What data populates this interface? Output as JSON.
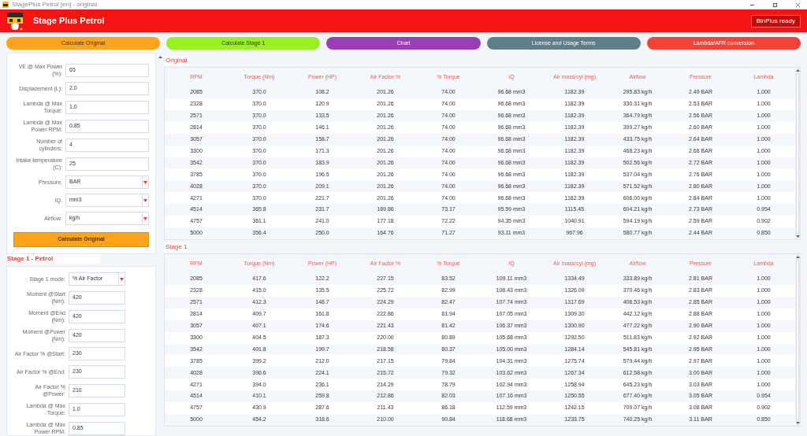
{
  "window": {
    "title": "StagePlus Petrol [en] - original"
  },
  "header": {
    "title": "Stage Plus Petrol",
    "status": "BinPlus ready"
  },
  "nav_buttons": [
    {
      "label": "Calculate Original",
      "color": "#ffa31a"
    },
    {
      "label": "Calculate Stage 1",
      "color": "#99f020"
    },
    {
      "label": "Chart",
      "color": "#9b3db5"
    },
    {
      "label": "License and Usage Terms",
      "color": "#607d8b"
    },
    {
      "label": "Lambda/AFR conversion",
      "color": "#f44336"
    }
  ],
  "original_form": {
    "fields": [
      {
        "label": "VE @ Max Power (%):",
        "kind": "text",
        "value": "65"
      },
      {
        "label": "Displacement (L):",
        "kind": "text",
        "value": "2.0"
      },
      {
        "label": "Lambda @ Max Torque:",
        "kind": "text",
        "value": "1.0"
      },
      {
        "label": "Lambda @ Max Power RPM:",
        "kind": "text",
        "value": "0.85"
      },
      {
        "label": "Number of cylinders:",
        "kind": "text",
        "value": "4"
      },
      {
        "label": "Intake temperature (C):",
        "kind": "text",
        "value": "25"
      },
      {
        "label": "Pressure:",
        "kind": "select",
        "value": "BAR"
      },
      {
        "label": "IQ:",
        "kind": "select",
        "value": "mm3"
      },
      {
        "label": "Airflow:",
        "kind": "select",
        "value": "kg/h"
      }
    ],
    "button": "Calculate Original"
  },
  "stage1_form": {
    "title": "Stage 1 - Petrol",
    "fields": [
      {
        "label": "Stage 1 mode:",
        "kind": "select",
        "value": "% Air Factor"
      },
      {
        "label": "Moment @Start (Nm):",
        "kind": "text",
        "value": "420"
      },
      {
        "label": "Moment @End (Nm):",
        "kind": "text",
        "value": "420"
      },
      {
        "label": "Moment @Power (Nm):",
        "kind": "text",
        "value": "420"
      },
      {
        "label": "Air Factor % @Start:",
        "kind": "text",
        "value": "230"
      },
      {
        "label": "Air Factor % @End:",
        "kind": "text",
        "value": "230"
      },
      {
        "label": "Air Factor % @Power:",
        "kind": "text",
        "value": "210"
      },
      {
        "label": "Lambda @ Max Torque:",
        "kind": "text",
        "value": "1.0"
      },
      {
        "label": "Lambda @ Max Power RPM:",
        "kind": "text",
        "value": "0.85"
      }
    ]
  },
  "tables": [
    {
      "title": "Original",
      "columns": [
        "RPM",
        "Torque (Nm)",
        "Power (HP)",
        "Air Factor %",
        "% Torque",
        "IQ",
        "Air mass/cyl (mg)",
        "Airflow",
        "Pressure",
        "Lambda"
      ],
      "rows": [
        [
          "2085",
          "370.0",
          "108.2",
          "201.26",
          "74.00",
          "96.68 mm3",
          "1182.39",
          "295.83 kg/h",
          "2.49 BAR",
          "1.000"
        ],
        [
          "2328",
          "370.0",
          "120.9",
          "201.26",
          "74.00",
          "96.68 mm3",
          "1182.39",
          "330.31 kg/h",
          "2.53 BAR",
          "1.000"
        ],
        [
          "2571",
          "370.0",
          "133.5",
          "201.26",
          "74.00",
          "96.68 mm3",
          "1182.39",
          "364.79 kg/h",
          "2.56 BAR",
          "1.000"
        ],
        [
          "2814",
          "370.0",
          "146.1",
          "201.26",
          "74.00",
          "96.68 mm3",
          "1182.39",
          "399.27 kg/h",
          "2.60 BAR",
          "1.000"
        ],
        [
          "3057",
          "370.0",
          "158.7",
          "201.26",
          "74.00",
          "96.68 mm3",
          "1182.39",
          "433.75 kg/h",
          "2.64 BAR",
          "1.000"
        ],
        [
          "3300",
          "370.0",
          "171.3",
          "201.26",
          "74.00",
          "96.68 mm3",
          "1182.39",
          "468.23 kg/h",
          "2.68 BAR",
          "1.000"
        ],
        [
          "3542",
          "370.0",
          "183.9",
          "201.26",
          "74.00",
          "96.68 mm3",
          "1182.39",
          "502.56 kg/h",
          "2.72 BAR",
          "1.000"
        ],
        [
          "3785",
          "370.0",
          "196.5",
          "201.26",
          "74.00",
          "96.68 mm3",
          "1182.39",
          "537.04 kg/h",
          "2.76 BAR",
          "1.000"
        ],
        [
          "4028",
          "370.0",
          "209.1",
          "201.26",
          "74.00",
          "96.68 mm3",
          "1182.39",
          "571.52 kg/h",
          "2.80 BAR",
          "1.000"
        ],
        [
          "4271",
          "370.0",
          "221.7",
          "201.26",
          "74.00",
          "96.68 mm3",
          "1182.39",
          "606.00 kg/h",
          "2.84 BAR",
          "1.000"
        ],
        [
          "4514",
          "365.8",
          "231.7",
          "189.86",
          "73.17",
          "95.59 mm3",
          "1115.45",
          "604.21 kg/h",
          "2.73 BAR",
          "0.954"
        ],
        [
          "4757",
          "361.1",
          "241.0",
          "177.18",
          "72.22",
          "94.35 mm3",
          "1040.91",
          "594.19 kg/h",
          "2.59 BAR",
          "0.902"
        ],
        [
          "5000",
          "356.4",
          "250.0",
          "164.76",
          "71.27",
          "93.11 mm3",
          "967.96",
          "580.77 kg/h",
          "2.44 BAR",
          "0.850"
        ]
      ]
    },
    {
      "title": "Stage 1",
      "columns": [
        "RPM",
        "Torque (Nm)",
        "Power (HP)",
        "Air Factor %",
        "% Torque",
        "IQ",
        "Air mass/cyl (mg)",
        "Airflow",
        "Pressure",
        "Lambda"
      ],
      "rows": [
        [
          "2085",
          "417.6",
          "122.2",
          "227.15",
          "83.52",
          "109.11 mm3",
          "1334.49",
          "333.89 kg/h",
          "2.81 BAR",
          "1.000"
        ],
        [
          "2328",
          "415.0",
          "135.5",
          "225.72",
          "82.99",
          "108.43 mm3",
          "1326.09",
          "370.46 kg/h",
          "2.83 BAR",
          "1.000"
        ],
        [
          "2571",
          "412.3",
          "148.7",
          "224.29",
          "82.47",
          "107.74 mm3",
          "1317.69",
          "406.53 kg/h",
          "2.85 BAR",
          "1.000"
        ],
        [
          "2814",
          "409.7",
          "161.8",
          "222.86",
          "81.94",
          "107.05 mm3",
          "1309.30",
          "442.12 kg/h",
          "2.88 BAR",
          "1.000"
        ],
        [
          "3057",
          "407.1",
          "174.6",
          "221.43",
          "81.42",
          "106.37 mm3",
          "1300.90",
          "477.22 kg/h",
          "2.90 BAR",
          "1.000"
        ],
        [
          "3300",
          "404.5",
          "187.3",
          "220.00",
          "80.89",
          "105.68 mm3",
          "1292.50",
          "511.83 kg/h",
          "2.92 BAR",
          "1.000"
        ],
        [
          "3542",
          "401.8",
          "199.7",
          "218.58",
          "80.37",
          "105.00 mm3",
          "1284.14",
          "545.81 kg/h",
          "2.95 BAR",
          "1.000"
        ],
        [
          "3785",
          "399.2",
          "212.0",
          "217.15",
          "79.84",
          "104.31 mm3",
          "1275.74",
          "579.44 kg/h",
          "2.97 BAR",
          "1.000"
        ],
        [
          "4028",
          "396.6",
          "224.1",
          "215.72",
          "79.32",
          "103.62 mm3",
          "1267.34",
          "612.58 kg/h",
          "3.00 BAR",
          "1.000"
        ],
        [
          "4271",
          "394.0",
          "236.1",
          "214.29",
          "78.79",
          "102.94 mm3",
          "1258.94",
          "645.23 kg/h",
          "3.03 BAR",
          "1.000"
        ],
        [
          "4514",
          "410.1",
          "259.8",
          "212.86",
          "82.03",
          "107.16 mm3",
          "1250.55",
          "677.40 kg/h",
          "3.05 BAR",
          "0.954"
        ],
        [
          "4757",
          "430.9",
          "287.6",
          "211.43",
          "86.18",
          "112.59 mm3",
          "1242.15",
          "709.07 kg/h",
          "3.08 BAR",
          "0.902"
        ],
        [
          "5000",
          "454.2",
          "318.6",
          "210.00",
          "90.84",
          "118.68 mm3",
          "1233.75",
          "740.25 kg/h",
          "3.11 BAR",
          "0.850"
        ]
      ]
    }
  ]
}
